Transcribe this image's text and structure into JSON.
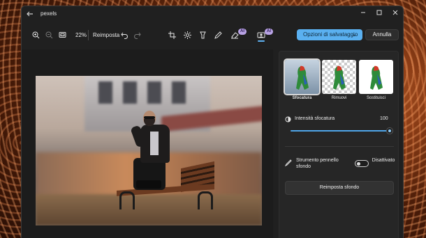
{
  "window": {
    "title": "pexels",
    "back_icon": "back-arrow-icon",
    "minimize_icon": "minimize-icon",
    "maximize_icon": "maximize-icon",
    "close_icon": "close-icon"
  },
  "toolbar": {
    "zoom_level": "22%",
    "reset_label": "Reimposta",
    "ai_badge": "AI",
    "save_label": "Opzioni di salvataggio",
    "cancel_label": "Annulla",
    "icons": [
      "zoom-in-icon",
      "zoom-out-icon",
      "fit-to-window-icon",
      "undo-icon",
      "redo-icon",
      "crop-icon",
      "adjust-icon",
      "filter-icon",
      "markup-icon",
      "erase-icon",
      "background-icon"
    ]
  },
  "panel": {
    "options": [
      {
        "label": "Sfocatura",
        "selected": true
      },
      {
        "label": "Rimuovi",
        "selected": false
      },
      {
        "label": "Sostituisci",
        "selected": false
      }
    ],
    "blur_label": "Intensità sfocatura",
    "blur_value": "100",
    "blur_level": 1.0,
    "brush_label": "Strumento pennello sfondo",
    "toggle_state": "Disattivato",
    "toggle_on": false,
    "reset_bg_label": "Reimposta sfondo"
  },
  "colors": {
    "accent": "#5ab0f0",
    "ai_badge": "#b9a3e6",
    "window_bg": "#202020",
    "panel_bg": "#262626"
  }
}
